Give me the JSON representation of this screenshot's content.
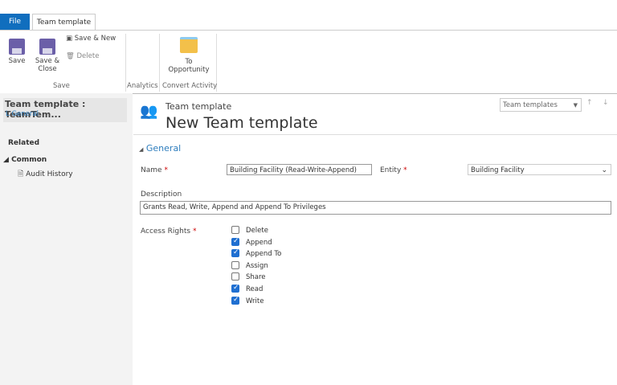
{
  "tabs": {
    "file": "File",
    "team_template": "Team template"
  },
  "ribbon": {
    "save": "Save",
    "save_close": "Save & Close",
    "save_new": "Save & New",
    "delete": "Delete",
    "to_opportunity": "To Opportunity",
    "groups": {
      "save": "Save",
      "analytics": "Analytics",
      "convert": "Convert Activity"
    }
  },
  "left": {
    "record_title": "Team template : TeamTem...",
    "general_link": "L General",
    "related": "Related",
    "common": "Common",
    "audit_history": "Audit History"
  },
  "header": {
    "entity": "Team template",
    "title": "New Team template",
    "view_selector": "Team templates"
  },
  "form": {
    "section": "General",
    "name_label": "Name",
    "name_value": "Building Facility (Read-Write-Append)",
    "entity_label": "Entity",
    "entity_value": "Building Facility",
    "description_label": "Description",
    "description_value": "Grants Read, Write, Append and Append To Privileges",
    "access_label": "Access Rights",
    "rights": [
      {
        "label": "Delete",
        "checked": false
      },
      {
        "label": "Append",
        "checked": true
      },
      {
        "label": "Append To",
        "checked": true
      },
      {
        "label": "Assign",
        "checked": false
      },
      {
        "label": "Share",
        "checked": false
      },
      {
        "label": "Read",
        "checked": true
      },
      {
        "label": "Write",
        "checked": true
      }
    ]
  },
  "colors": {
    "file_tab": "#106ebe",
    "link": "#2e7dbd",
    "check": "#1f6fd1"
  }
}
